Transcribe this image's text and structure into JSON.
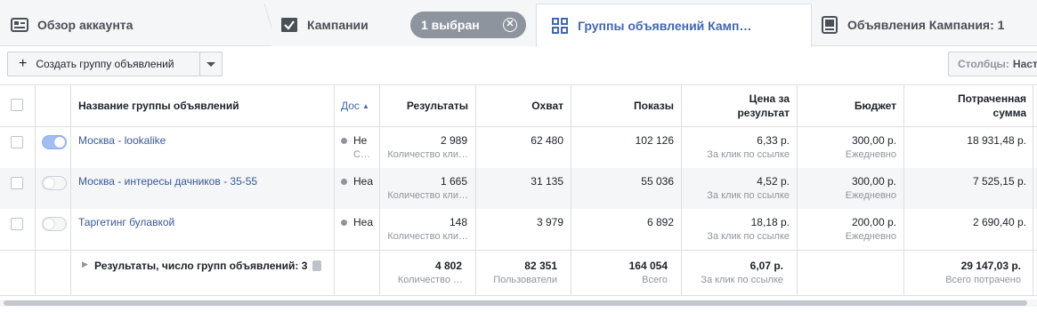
{
  "tabs": {
    "overview": "Обзор аккаунта",
    "campaigns": "Кампании",
    "selected_pill": "1 выбран",
    "adsets": "Группы объявлений Камп…",
    "ads": "Объявления Кампания: 1"
  },
  "toolbar": {
    "create_label": "Создать группу объявлений",
    "columns_label": "Столбцы:",
    "columns_value": "Наст"
  },
  "columns": {
    "name": "Название группы объявлений",
    "delivery": "Дос",
    "results": "Результаты",
    "reach": "Охват",
    "impressions": "Показы",
    "cost_per_result_1": "Цена за",
    "cost_per_result_2": "результат",
    "budget": "Бюджет",
    "spent_1": "Потраченная",
    "spent_2": "сумма"
  },
  "rows": [
    {
      "name": "Москва - lookalike",
      "toggle": "on",
      "delivery": "Не",
      "delivery_sub": "С…",
      "results": "2 989",
      "results_sub": "Количество кли…",
      "reach": "62 480",
      "impressions": "102 126",
      "cpr": "6,33 р.",
      "cpr_sub": "За клик по ссылке",
      "budget": "300,00 р.",
      "budget_sub": "Ежедневно",
      "spent": "18 931,48 р."
    },
    {
      "name": "Москва - интересы дачников - 35-55",
      "toggle": "off",
      "delivery": "Неа",
      "delivery_sub": "",
      "results": "1 665",
      "results_sub": "Количество кли…",
      "reach": "31 135",
      "impressions": "55 036",
      "cpr": "4,52 р.",
      "cpr_sub": "За клик по ссылке",
      "budget": "300,00 р.",
      "budget_sub": "Ежедневно",
      "spent": "7 525,15 р."
    },
    {
      "name": "Таргетинг булавкой",
      "toggle": "off",
      "delivery": "Неа",
      "delivery_sub": "",
      "results": "148",
      "results_sub": "Количество кли…",
      "reach": "3 979",
      "impressions": "6 892",
      "cpr": "18,18 р.",
      "cpr_sub": "За клик по ссылке",
      "budget": "200,00 р.",
      "budget_sub": "Ежедневно",
      "spent": "2 690,40 р."
    }
  ],
  "total": {
    "label": "Результаты, число групп объявлений: 3",
    "results": "4 802",
    "results_sub": "Количество …",
    "reach": "82 351",
    "reach_sub": "Пользователи",
    "impressions": "164 054",
    "impressions_sub": "Всего",
    "cpr": "6,07 р.",
    "cpr_sub": "За клик по ссылке",
    "spent": "29 147,03 р.",
    "spent_sub": "Всего потрачено"
  },
  "colors": {
    "link": "#365899",
    "active_tab": "#4267b2",
    "toggle_on": "#a2bdf2"
  }
}
